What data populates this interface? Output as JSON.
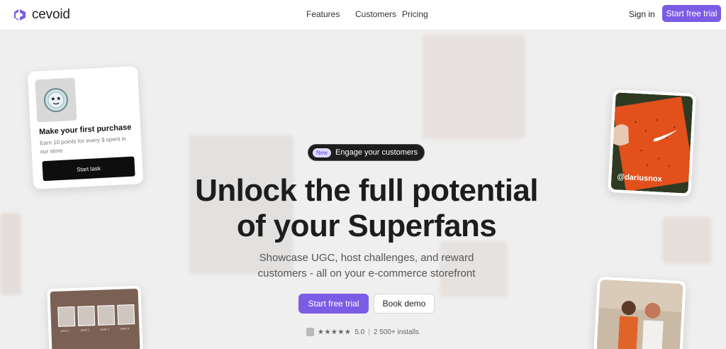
{
  "nav": {
    "logo_text": "cevoid",
    "links": [
      "Features",
      "Customers",
      "Pricing"
    ],
    "sign_in": "Sign in",
    "cta": "Start free trial"
  },
  "task_card": {
    "title": "Make your first purchase",
    "subtitle": "Earn 10 points for every $ spent in our store",
    "button": "Start task"
  },
  "nike_card": {
    "handle": "@dariusnox"
  },
  "brown_card": {
    "thumb_labels": [
      "week 1",
      "week 2",
      "week 3",
      "week 4"
    ]
  },
  "hero": {
    "badge_new": "New",
    "badge_text": "Engage your customers",
    "title_line1": "Unlock the full potential",
    "title_line2": "of your Superfans",
    "subtitle_line1": "Showcase UGC, host challenges, and reward",
    "subtitle_line2": "customers - all on your e-commerce storefront",
    "cta_primary": "Start free trial",
    "cta_secondary": "Book demo",
    "stars": "★★★★★",
    "rating": "5.0",
    "installs": "2 500+ installs"
  },
  "colors": {
    "accent": "#7b5ce5",
    "dark": "#1d1d1d"
  }
}
